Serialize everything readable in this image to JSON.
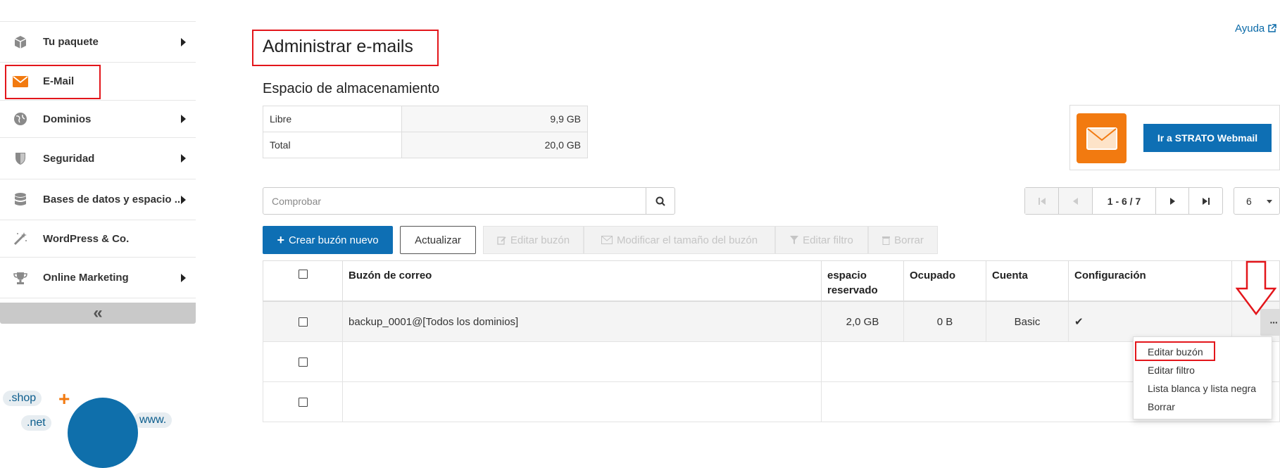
{
  "sidebar": {
    "items": [
      {
        "label": "Tu paquete",
        "icon": "package-icon",
        "has_arrow": true
      },
      {
        "label": "E-Mail",
        "icon": "envelope-icon",
        "has_arrow": false,
        "active": true
      },
      {
        "label": "Dominios",
        "icon": "globe-icon",
        "has_arrow": true
      },
      {
        "label": "Seguridad",
        "icon": "shield-icon",
        "has_arrow": true
      },
      {
        "label": "Bases de datos y espacio ...",
        "icon": "database-icon",
        "has_arrow": true
      },
      {
        "label": "WordPress & Co.",
        "icon": "magic-wand-icon",
        "has_arrow": false
      },
      {
        "label": "Online Marketing",
        "icon": "trophy-icon",
        "has_arrow": true
      }
    ],
    "collapse_label": "«",
    "promo": {
      "bubble1": ".shop",
      "bubble2": ".net",
      "bubble3": "www."
    }
  },
  "header": {
    "help_label": "Ayuda",
    "title": "Administrar e-mails"
  },
  "storage": {
    "title": "Espacio de almacenamiento",
    "rows": [
      {
        "label": "Libre",
        "value": "9,9 GB"
      },
      {
        "label": "Total",
        "value": "20,0 GB"
      }
    ]
  },
  "webmail": {
    "button_label": "Ir a STRATO Webmail"
  },
  "search": {
    "placeholder": "Comprobar"
  },
  "pagination": {
    "info": "1 - 6 / 7",
    "per_page": "6"
  },
  "toolbar": {
    "create_label": "Crear buzón nuevo",
    "refresh_label": "Actualizar",
    "edit_label": "Editar buzón",
    "resize_label": "Modificar el tamaño del buzón",
    "filter_label": "Editar filtro",
    "delete_label": "Borrar"
  },
  "table": {
    "columns": {
      "mailbox": "Buzón de correo",
      "reserved": "espacio reservado",
      "used": "Ocupado",
      "account": "Cuenta",
      "config": "Configuración"
    },
    "rows": [
      {
        "mailbox": "backup_0001@[Todos los dominios]",
        "reserved": "2,0 GB",
        "used": "0 B",
        "account": "Basic",
        "config": "✔"
      },
      {
        "mailbox": "",
        "reserved": "",
        "used": "",
        "account": "",
        "config": ""
      },
      {
        "mailbox": "",
        "reserved": "",
        "used": "",
        "account": "",
        "config": ""
      }
    ],
    "more_label": "···"
  },
  "context_menu": {
    "items": [
      "Editar buzón",
      "Editar filtro",
      "Lista blanca y lista negra",
      "Borrar"
    ]
  },
  "colors": {
    "accent_blue": "#0e6fb4",
    "highlight_red": "#e3161b",
    "email_orange": "#f27a10"
  }
}
